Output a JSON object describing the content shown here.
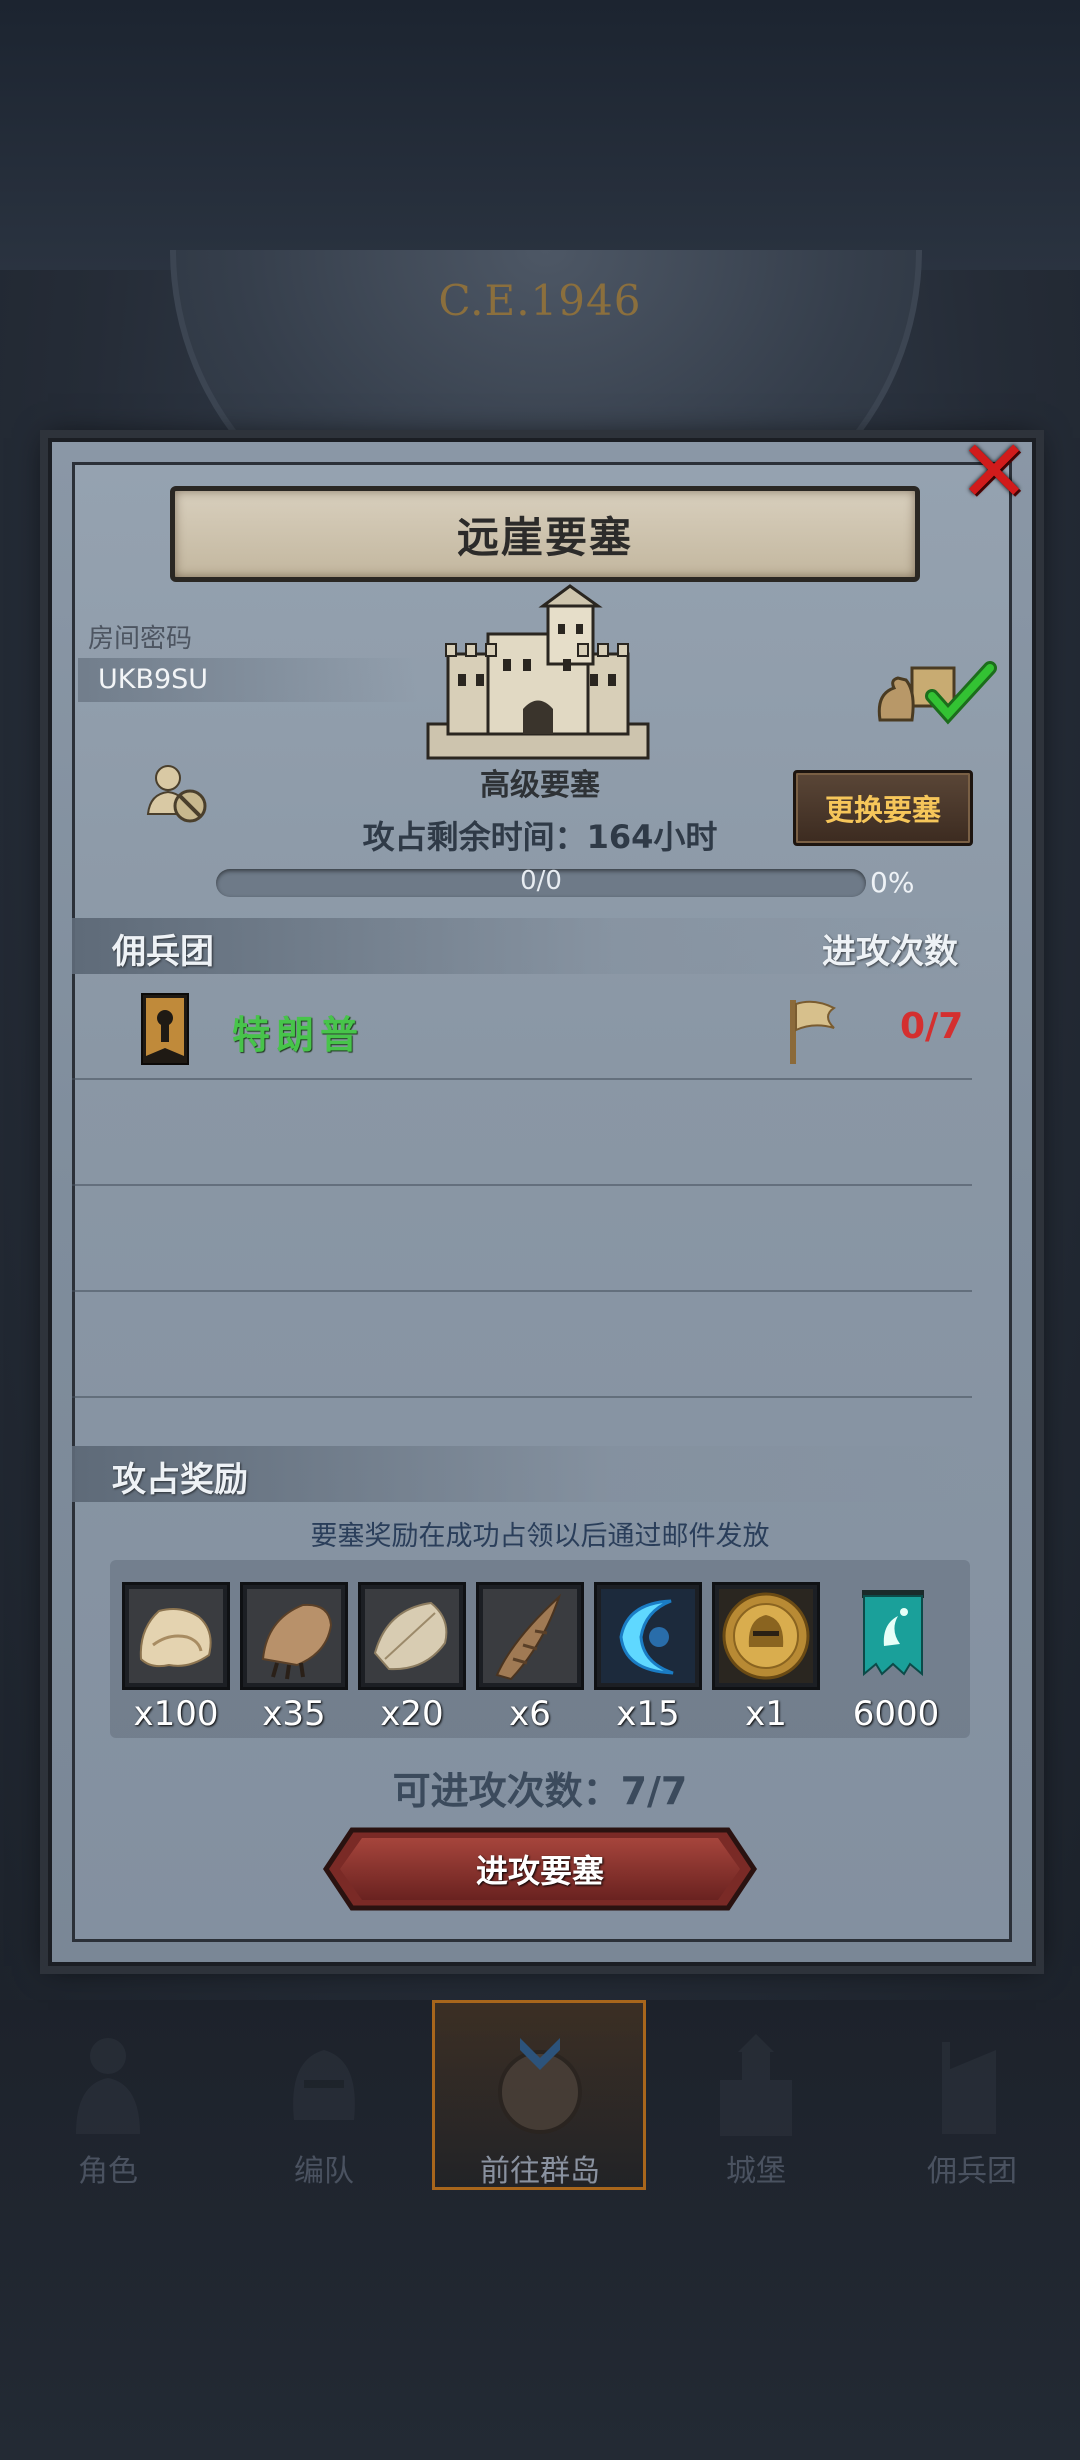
{
  "background": {
    "era": "C.E.1946"
  },
  "dialog": {
    "title": "远崖要塞",
    "room_label": "房间密码",
    "room_code": "UKB9SU",
    "fort_grade": "高级要塞",
    "attack_time": "攻占剩余时间：164小时",
    "change_button": "更换要塞",
    "progress": {
      "text": "0/0",
      "percent_label": "0%",
      "fraction": 0
    },
    "mercenary_header": "佣兵团",
    "attack_count_header": "进攻次数",
    "mercenaries": [
      {
        "name": "特朗普",
        "attacks": "0/7"
      }
    ],
    "reward_header": "攻占奖励",
    "reward_note": "要塞奖励在成功占领以后通过邮件发放",
    "rewards": [
      {
        "icon": "fur-pelt-icon",
        "qty": "x100"
      },
      {
        "icon": "claw-icon",
        "qty": "x35"
      },
      {
        "icon": "feather-pelt-icon",
        "qty": "x20"
      },
      {
        "icon": "horn-icon",
        "qty": "x6"
      },
      {
        "icon": "blue-crescent-icon",
        "qty": "x15"
      },
      {
        "icon": "golden-helmet-medal-icon",
        "qty": "x1"
      },
      {
        "icon": "teal-banner-icon",
        "qty": "6000"
      }
    ],
    "attacks_left": "可进攻次数：7/7",
    "attack_button": "进攻要塞"
  },
  "nav": {
    "items": [
      {
        "label": "角色",
        "icon": "knight-icon"
      },
      {
        "label": "编队",
        "icon": "helmet-icon"
      },
      {
        "label": "前往群岛",
        "icon": "island-compass-icon"
      },
      {
        "label": "城堡",
        "icon": "castle-icon"
      },
      {
        "label": "佣兵团",
        "icon": "mercenary-icon"
      }
    ],
    "active_index": 2
  },
  "colors": {
    "accent_green": "#47c44a",
    "count_red": "#d42f2f",
    "button_gold": "#f6c65a",
    "close_red": "#d11b1b"
  }
}
